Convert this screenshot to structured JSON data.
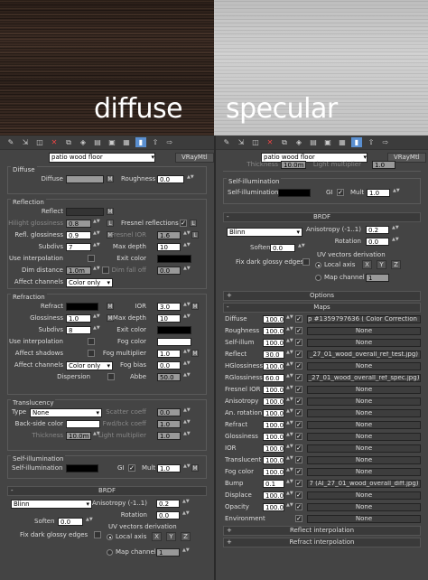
{
  "captions": {
    "diffuse": "diffuse",
    "specular": "specular"
  },
  "toolbar_icons": [
    "pick-material-icon",
    "put-to-scene-icon",
    "assign-to-selection-icon",
    "reset-map-icon",
    "copy-material-icon",
    "make-unique-icon",
    "put-to-library-icon",
    "material-id-icon",
    "show-in-viewport-icon",
    "show-end-result-icon",
    "go-to-parent-icon",
    "go-forward-icon"
  ],
  "left": {
    "material_name": "patio wood floor",
    "material_type": "VRayMtl",
    "diffuse": {
      "title": "Diffuse",
      "diffuse_label": "Diffuse",
      "m": "M",
      "roughness_label": "Roughness",
      "roughness": "0.0"
    },
    "reflection": {
      "title": "Reflection",
      "reflect": "Reflect",
      "m": "M",
      "hilight_glossiness": "Hilight glossiness",
      "hilight_val": "0.8",
      "l": "L",
      "fresnel": "Fresnel reflections",
      "refl_glossiness": "Refl. glossiness",
      "refl_val": "0.9",
      "subdivs": "Subdivs",
      "subdivs_val": "7",
      "fresnel_ior": "Fresnel IOR",
      "fresnel_val": "1.6",
      "max_depth": "Max depth",
      "max_depth_val": "10",
      "use_interp": "Use interpolation",
      "exit_color": "Exit color",
      "dim_distance": "Dim distance",
      "dim_val": "1.0m",
      "dim_falloff": "Dim fall off",
      "dim_falloff_val": "0.0",
      "affect_channels": "Affect channels",
      "affect_val": "Color only"
    },
    "refraction": {
      "title": "Refraction",
      "refract": "Refract",
      "ior": "IOR",
      "ior_val": "3.0",
      "glossiness": "Glossiness",
      "gloss_val": "1.0",
      "max_depth": "Max depth",
      "max_depth_val": "10",
      "subdivs": "Subdivs",
      "subdivs_val": "8",
      "exit_color": "Exit color",
      "use_interp": "Use interpolation",
      "fog_color": "Fog color",
      "affect_shadows": "Affect shadows",
      "fog_mult": "Fog multiplier",
      "fog_mult_val": "1.0",
      "affect_channels": "Affect channels",
      "affect_val": "Color only",
      "fog_bias": "Fog bias",
      "fog_bias_val": "0.0",
      "dispersion": "Dispersion",
      "abbe": "Abbe",
      "abbe_val": "50.0"
    },
    "translucency": {
      "title": "Translucency",
      "type": "Type",
      "type_val": "None",
      "scatter": "Scatter coeff",
      "scatter_val": "0.0",
      "backside": "Back-side color",
      "fwd": "Fwd/bck coeff",
      "fwd_val": "1.0",
      "thickness": "Thickness",
      "thickness_val": "10.0m",
      "light_mult": "Light multiplier",
      "light_mult_val": "1.0"
    },
    "selfillum": {
      "title": "Self-illumination",
      "label": "Self-illumination",
      "gi": "GI",
      "mult": "Mult",
      "mult_val": "1.0"
    },
    "brdf": {
      "title": "BRDF",
      "type": "Blinn",
      "aniso": "Anisotropy (-1..1)",
      "aniso_val": "0.2",
      "rotation": "Rotation",
      "rotation_val": "0.0",
      "soften": "Soften",
      "soften_val": "0.0",
      "fix": "Fix dark glossy edges",
      "uv": "UV vectors derivation",
      "local": "Local axis",
      "x": "X",
      "y": "Y",
      "z": "Z",
      "mapch": "Map channel",
      "mapch_val": "1"
    }
  },
  "right": {
    "material_name": "patio wood floor",
    "material_type": "VRayMtl",
    "top": {
      "thickness": "Thickness",
      "thickness_val": "10.0m",
      "light_mult": "Light multiplier",
      "light_mult_val": "1.0"
    },
    "selfillum": {
      "title": "Self-illumination",
      "label": "Self-illumination",
      "gi": "GI",
      "mult": "Mult",
      "mult_val": "1.0"
    },
    "brdf": {
      "title": "BRDF",
      "type": "Blinn",
      "aniso": "Anisotropy (-1..1)",
      "aniso_val": "0.2",
      "rotation": "Rotation",
      "rotation_val": "0.0",
      "soften": "Soften",
      "soften_val": "0.0",
      "fix": "Fix dark glossy edges",
      "uv": "UV vectors derivation",
      "local": "Local axis",
      "x": "X",
      "y": "Y",
      "z": "Z",
      "mapch": "Map channel",
      "mapch_val": "1"
    },
    "options": "Options",
    "maps": "Maps",
    "map_rows": [
      {
        "name": "Diffuse",
        "val": "100.0",
        "map": "p #1359797636  ( Color Correction )"
      },
      {
        "name": "Roughness",
        "val": "100.0",
        "map": "None"
      },
      {
        "name": "Self-illum",
        "val": "100.0",
        "map": "None"
      },
      {
        "name": "Reflect",
        "val": "30.0",
        "map": "_27_01_wood_overall_ref_test.jpg)"
      },
      {
        "name": "HGlossiness",
        "val": "100.0",
        "map": "None"
      },
      {
        "name": "RGlossiness",
        "val": "60.0",
        "map": "_27_01_wood_overall_ref_spec.jpg)"
      },
      {
        "name": "Fresnel IOR",
        "val": "100.0",
        "map": "None"
      },
      {
        "name": "Anisotropy",
        "val": "100.0",
        "map": "None"
      },
      {
        "name": "An. rotation",
        "val": "100.0",
        "map": "None"
      },
      {
        "name": "Refract",
        "val": "100.0",
        "map": "None"
      },
      {
        "name": "Glossiness",
        "val": "100.0",
        "map": "None"
      },
      {
        "name": "IOR",
        "val": "100.0",
        "map": "None"
      },
      {
        "name": "Translucent",
        "val": "100.0",
        "map": "None"
      },
      {
        "name": "Fog color",
        "val": "100.0",
        "map": "None"
      },
      {
        "name": "Bump",
        "val": "0.1",
        "map": "7 (AI_27_01_wood_overall_diff.jpg)"
      },
      {
        "name": "Displace",
        "val": "100.0",
        "map": "None"
      },
      {
        "name": "Opacity",
        "val": "100.0",
        "map": "None"
      },
      {
        "name": "Environment",
        "val": "",
        "map": "None"
      }
    ],
    "reflect_interp": "Reflect interpolation",
    "refract_interp": "Refract interpolation"
  },
  "colors": {
    "diffuse_swatch": "#9a9a9a",
    "black_swatch": "#000000",
    "white_swatch": "#ffffff",
    "accent": "#5a8fd0"
  }
}
